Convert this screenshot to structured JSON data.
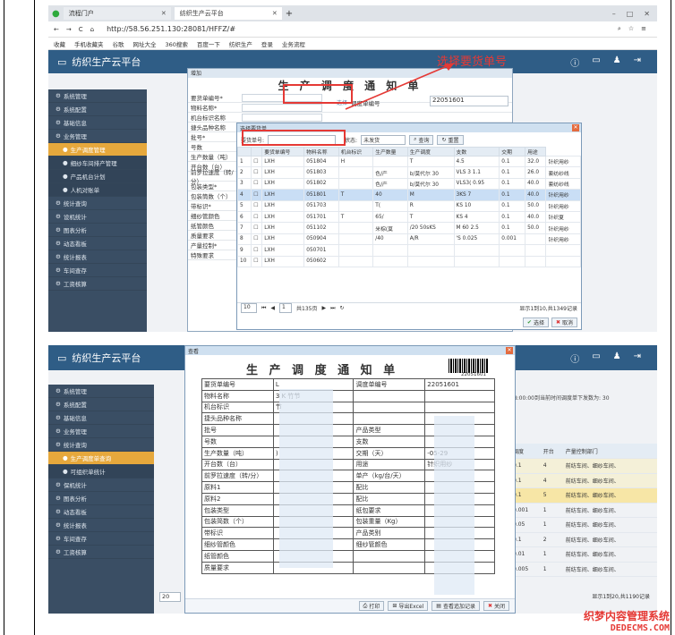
{
  "browser": {
    "tabs": [
      "流程门户",
      "纺织生产云平台"
    ],
    "url": "http://58.56.251.130:28081/HFFZ/#",
    "bookmarks": [
      "收藏",
      "手机收藏夹",
      "谷歌",
      "网址大全",
      "360搜索",
      "百度一下",
      "纺织生产",
      "登录",
      "业务流程"
    ]
  },
  "app": {
    "title": "纺织生产云平台",
    "sidebar1": [
      "系统管理",
      "系统配置",
      "基础信息",
      "业务管理",
      "生产调度管理",
      "细纱车间排产管理",
      "产品机台计划",
      "人机对账单",
      "统计查询",
      "设机统计",
      "图表分析",
      "动态看板",
      "统计报表",
      "车间查存",
      "工资核算"
    ],
    "sidebar2": [
      "系统管理",
      "系统配置",
      "基础信息",
      "业务管理",
      "统计查询",
      "生产调度单查询",
      "可组织单统计",
      "保机统计",
      "图表分析",
      "动态看板",
      "统计报表",
      "车间查存",
      "工资核算"
    ]
  },
  "form": {
    "window_title": "增加",
    "title": "生 产 调 度 通 知 单",
    "fields": [
      "要货单编号*",
      "物料名称*",
      "机台标识名称",
      "捷头品种名称",
      "批号*",
      "号数",
      "生产数量（吨）",
      "开台数（台）",
      "前罗拉速度（转/分）",
      "包装类型*",
      "包装筒数（个）",
      "带标识*",
      "细纱管颜色",
      "纸管颜色",
      "质量要求",
      "产量控制*",
      "特殊要求"
    ],
    "select_label": "选择",
    "order_no_label": "调度单编号",
    "order_no": "22051601"
  },
  "annotation": "选择要货单号",
  "dialog": {
    "title": "选择要货单",
    "search_label": "要货单号:",
    "status_label": "状态:",
    "status_value": "未发货",
    "query": "查询",
    "reset": "重置",
    "columns": [
      "",
      "",
      "要货单编号",
      "物料名称",
      "机台标识",
      "生产数量",
      "生产调度",
      "支数",
      "交期",
      "用途"
    ],
    "rows": [
      [
        "1",
        "LXH",
        "051804",
        "H",
        "",
        "T",
        "4.5",
        "0.1",
        "32.0",
        "针织用纱"
      ],
      [
        "2",
        "LXH",
        "051803",
        "",
        "色/产",
        "b/莫代尔 30",
        "VLS 3 1.1",
        "0.1",
        "26.0",
        "套纺纱线"
      ],
      [
        "3",
        "LXH",
        "051802",
        "",
        "色/产",
        "b/莫代尔 30",
        "VLS3( 0.95",
        "0.1",
        "40.0",
        "套纺纱线"
      ],
      [
        "4",
        "LXH",
        "051801",
        "T",
        "40",
        "M",
        "3KS 7",
        "0.1",
        "40.0",
        "针织用纱"
      ],
      [
        "5",
        "LXH",
        "051703",
        "",
        "T(",
        "R",
        "KS 10",
        "0.1",
        "50.0",
        "针织用纱"
      ],
      [
        "6",
        "LXH",
        "051701",
        "T",
        "65/",
        "T",
        "KS 4",
        "0.1",
        "40.0",
        "针织夏"
      ],
      [
        "7",
        "LXH",
        "051102",
        "",
        "米棕(莫",
        "/20 50sKS",
        "M 60 2.5",
        "0.1",
        "50.0",
        "针织用纱"
      ],
      [
        "8",
        "LXH",
        "050904",
        "",
        "/40",
        "A/R",
        "'S 0.025",
        "0.001",
        "",
        "针织用纱"
      ],
      [
        "9",
        "LXH",
        "050701",
        "",
        "",
        "",
        "",
        "",
        "",
        ""
      ],
      [
        "10",
        "LXH",
        "050602",
        "",
        "",
        "",
        "",
        "",
        "",
        ""
      ]
    ],
    "pager": {
      "size": "10",
      "page": "1",
      "total_pages": "共135页",
      "summary": "显示1到10,共1349记录"
    },
    "ok": "选择",
    "cancel": "取消"
  },
  "print": {
    "window_title": "查看",
    "title": "生 产 调 度 通 知 单",
    "barcode": "22051601",
    "rows": [
      [
        "要货单编号",
        "L",
        "调度单编号",
        "22051601"
      ],
      [
        "物料名称",
        "3 K 竹节",
        "",
        ""
      ],
      [
        "机台标识",
        "节",
        "",
        ""
      ],
      [
        "捷头品种名称",
        "",
        "",
        ""
      ],
      [
        "批号",
        "",
        "产品类型",
        ""
      ],
      [
        "号数",
        "",
        "支数",
        ""
      ],
      [
        "生产数量（吨）",
        ")",
        "交期（天）",
        "-05-29"
      ],
      [
        "开台数（台）",
        "",
        "用途",
        "针织用纱"
      ],
      [
        "前罗拉速度（转/分）",
        "",
        "单产（kg/台/天）",
        ""
      ],
      [
        "原料1",
        "",
        "配比",
        ""
      ],
      [
        "原料2",
        "",
        "配比",
        ""
      ],
      [
        "包装类型",
        "",
        "纸包要求",
        ""
      ],
      [
        "包装简数（个）",
        "",
        "包装重量（Kg）",
        ""
      ],
      [
        "带标识",
        "",
        "产品类别",
        ""
      ],
      [
        "细纱管颜色",
        "",
        "细纱管颜色",
        ""
      ],
      [
        "纸管颜色",
        "",
        "",
        ""
      ],
      [
        "质量要求",
        "",
        "",
        ""
      ]
    ],
    "buttons": [
      "打印",
      "导出Excel",
      "查看追加记录",
      "关闭"
    ]
  },
  "background2": {
    "info": "08:00:00到当前时间调度单下发数为: 30",
    "cols": [
      "调度",
      "开台",
      "产量控制部门"
    ],
    "rows": [
      [
        "0.1",
        "4",
        "前纺车间、细纱车间、"
      ],
      [
        "0.1",
        "4",
        "前纺车间、细纱车间、"
      ],
      [
        "0.1",
        "5",
        "前纺车间、细纱车间、"
      ],
      [
        "0.001",
        "1",
        "前纺车间、细纱车间、"
      ],
      [
        "0.05",
        "1",
        "前纺车间、细纱车间、"
      ],
      [
        "0.1",
        "2",
        "前纺车间、细纱车间、"
      ],
      [
        "0.01",
        "1",
        "前纺车间、细纱车间、"
      ],
      [
        "0.005",
        "1",
        "前纺车间、细纱车间、"
      ]
    ],
    "pager_size": "20",
    "summary": "显示1到20,共1190记录"
  },
  "watermark": [
    "织梦内容管理系统",
    "DEDECMS.COM"
  ]
}
